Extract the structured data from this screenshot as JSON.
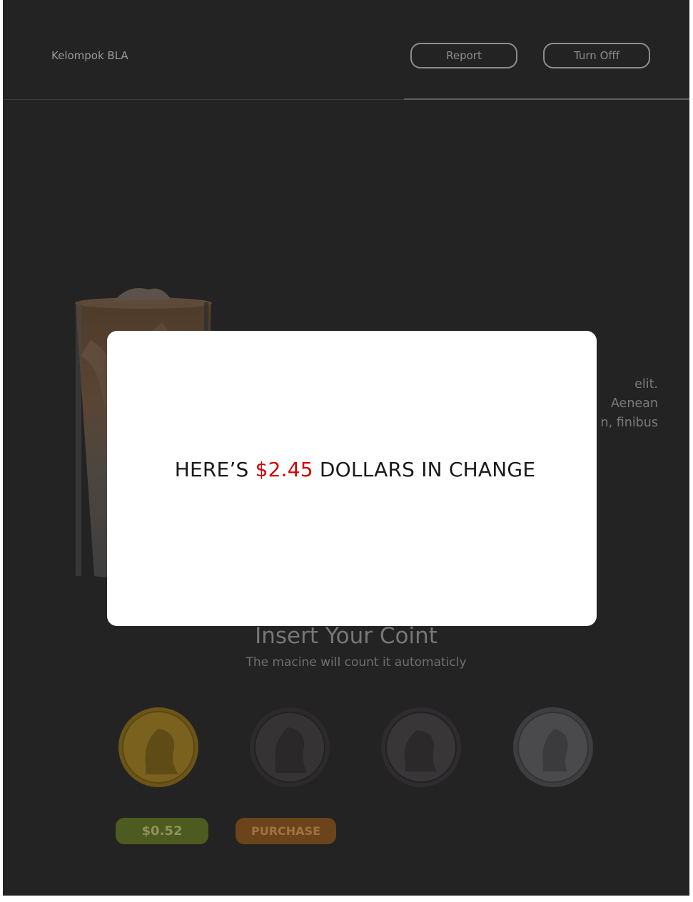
{
  "header": {
    "brand": "Kelompok BLA",
    "report_label": "Report",
    "turnoff_label": "Turn Offf"
  },
  "description": {
    "lines": [
      "elit.",
      "Aenean",
      "n, finibus"
    ]
  },
  "insert": {
    "title": "Insert Your Coint",
    "subtitle": "The macine will count it automaticly"
  },
  "coins": [
    "penny-icon",
    "nickel-icon",
    "dime-icon",
    "quarter-icon"
  ],
  "balance": "$0.52",
  "purchase_label": "PURCHASE",
  "modal": {
    "prefix": "HERE’S ",
    "amount": "$2.45",
    "suffix": " DOLLARS IN CHANGE"
  },
  "colors": {
    "background": "#232323",
    "balance": "#4d5b20",
    "purchase": "#6b441b",
    "amount": "#d40000"
  }
}
